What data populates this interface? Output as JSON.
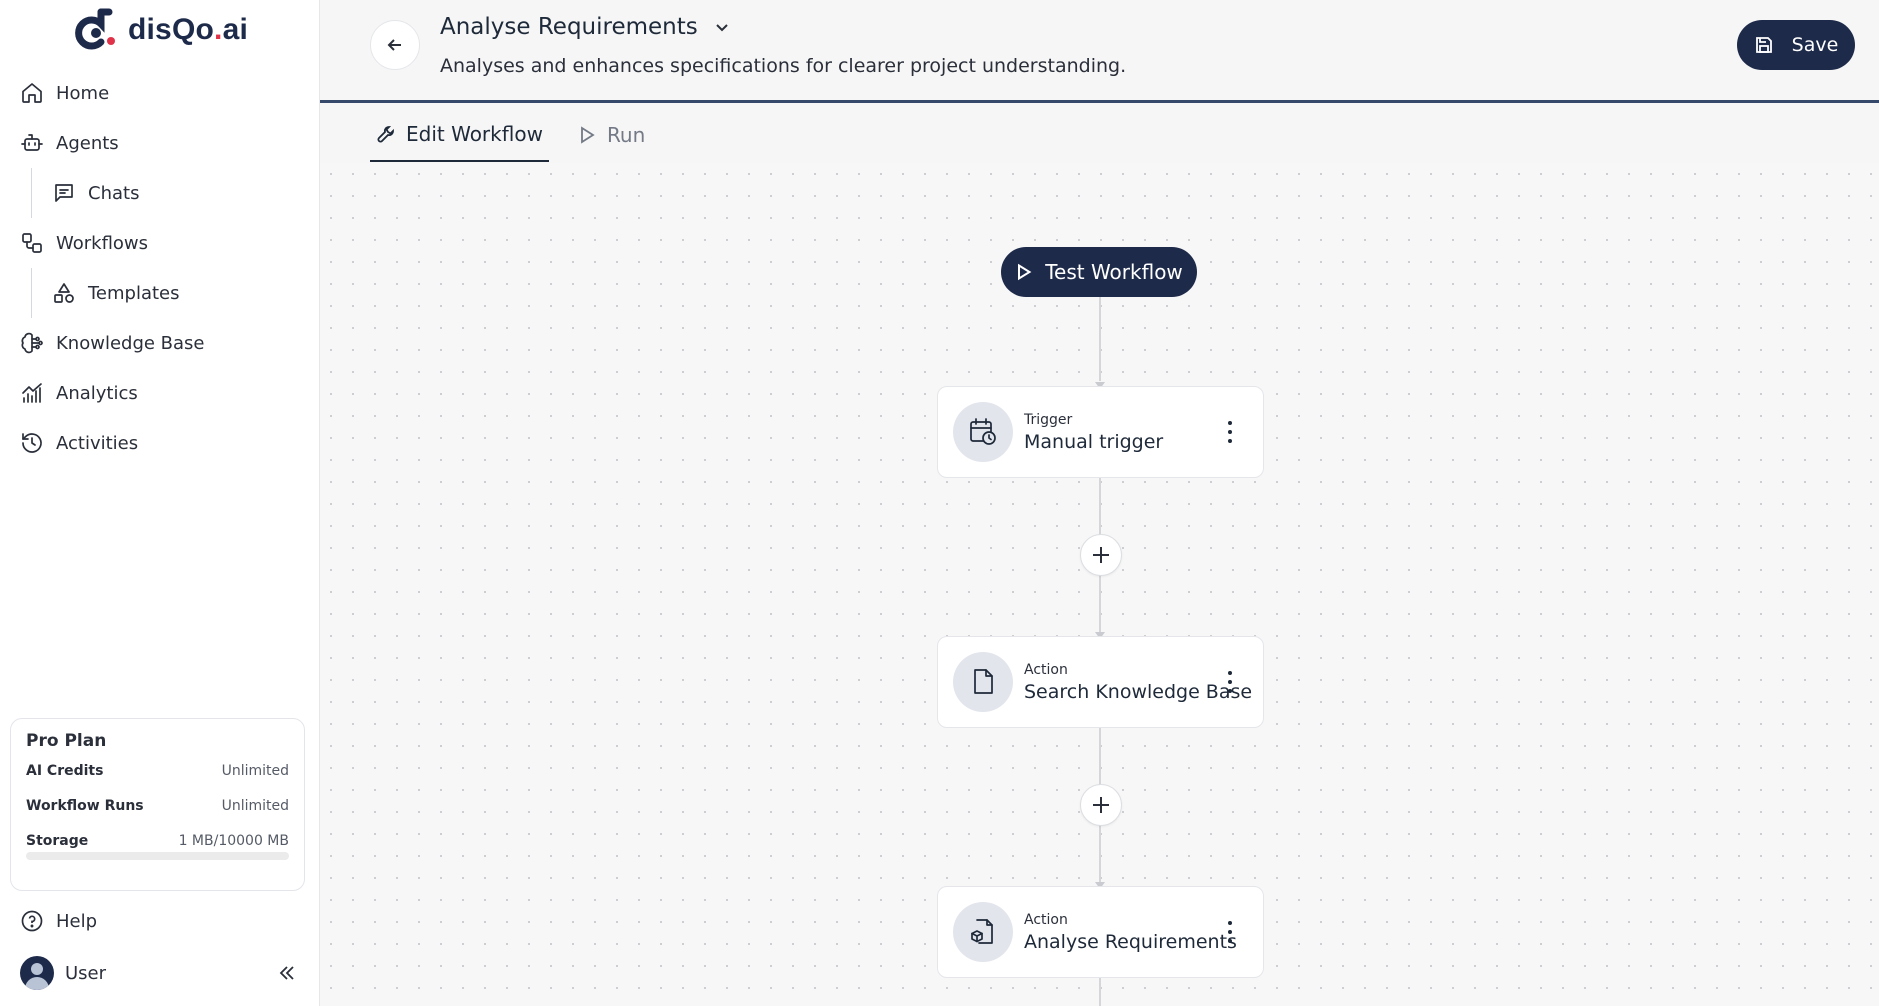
{
  "brand": {
    "name": "disQo",
    "dot": ".",
    "suffix": "ai"
  },
  "sidebar": {
    "items": [
      {
        "label": "Home",
        "icon": "home-icon"
      },
      {
        "label": "Agents",
        "icon": "bot-icon"
      },
      {
        "label": "Chats",
        "icon": "chat-icon"
      },
      {
        "label": "Workflows",
        "icon": "workflow-icon"
      },
      {
        "label": "Templates",
        "icon": "shapes-icon"
      },
      {
        "label": "Knowledge Base",
        "icon": "brain-icon"
      },
      {
        "label": "Analytics",
        "icon": "chart-icon"
      },
      {
        "label": "Activities",
        "icon": "history-icon"
      }
    ],
    "plan": {
      "title": "Pro Plan",
      "rows": [
        {
          "key": "AI Credits",
          "value": "Unlimited"
        },
        {
          "key": "Workflow Runs",
          "value": "Unlimited"
        },
        {
          "key": "Storage",
          "value": "1 MB/10000 MB"
        }
      ],
      "storage_fraction": 0.0001
    },
    "help_label": "Help",
    "user_label": "User"
  },
  "header": {
    "title": "Analyse Requirements",
    "subtitle": "Analyses and enhances specifications for clearer project understanding.",
    "save_label": "Save"
  },
  "tabs": [
    {
      "label": "Edit Workflow",
      "active": true,
      "icon": "wrench-icon"
    },
    {
      "label": "Run",
      "active": false,
      "icon": "play-icon"
    }
  ],
  "canvas": {
    "test_label": "Test Workflow",
    "nodes": [
      {
        "kind": "Trigger",
        "name": "Manual trigger",
        "icon": "calendar-clock-icon"
      },
      {
        "kind": "Action",
        "name": "Search Knowledge Base",
        "icon": "file-icon"
      },
      {
        "kind": "Action",
        "name": "Analyse Requirements",
        "icon": "file-box-icon"
      }
    ]
  },
  "colors": {
    "primary": "#1d2a4a",
    "accent_dot": "#e0334a",
    "header_rule": "#37496b"
  }
}
